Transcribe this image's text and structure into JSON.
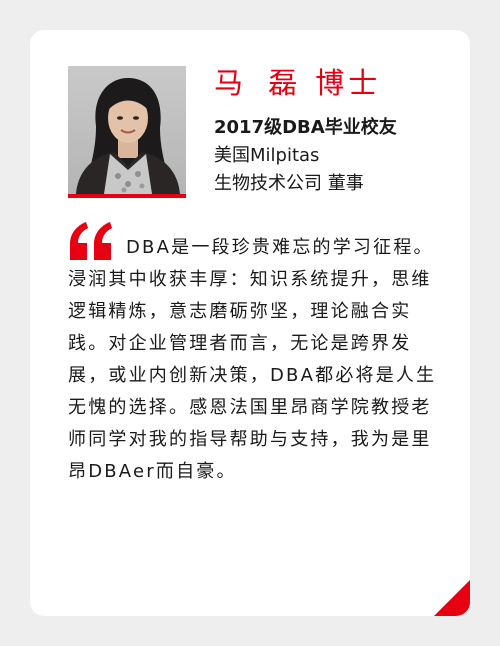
{
  "profile": {
    "name": "马 磊",
    "title": "博士",
    "alumni": "2017级DBA毕业校友",
    "company_line1": "美国Milpitas",
    "company_line2": "生物技术公司  董事"
  },
  "quote": {
    "icon": "quote-icon",
    "text": "DBA是一段珍贵难忘的学习征程。浸润其中收获丰厚：知识系统提升，思维逻辑精炼，意志磨砺弥坚，理论融合实践。对企业管理者而言，无论是跨界发展，或业内创新决策，DBA都必将是人生无愧的选择。感恩法国里昂商学院教授老师同学对我的指导帮助与支持，我为是里昂DBAer而自豪。"
  },
  "colors": {
    "accent": "#e60012",
    "background": "#eeeeee",
    "card": "#ffffff",
    "text": "#1a1a1a"
  }
}
